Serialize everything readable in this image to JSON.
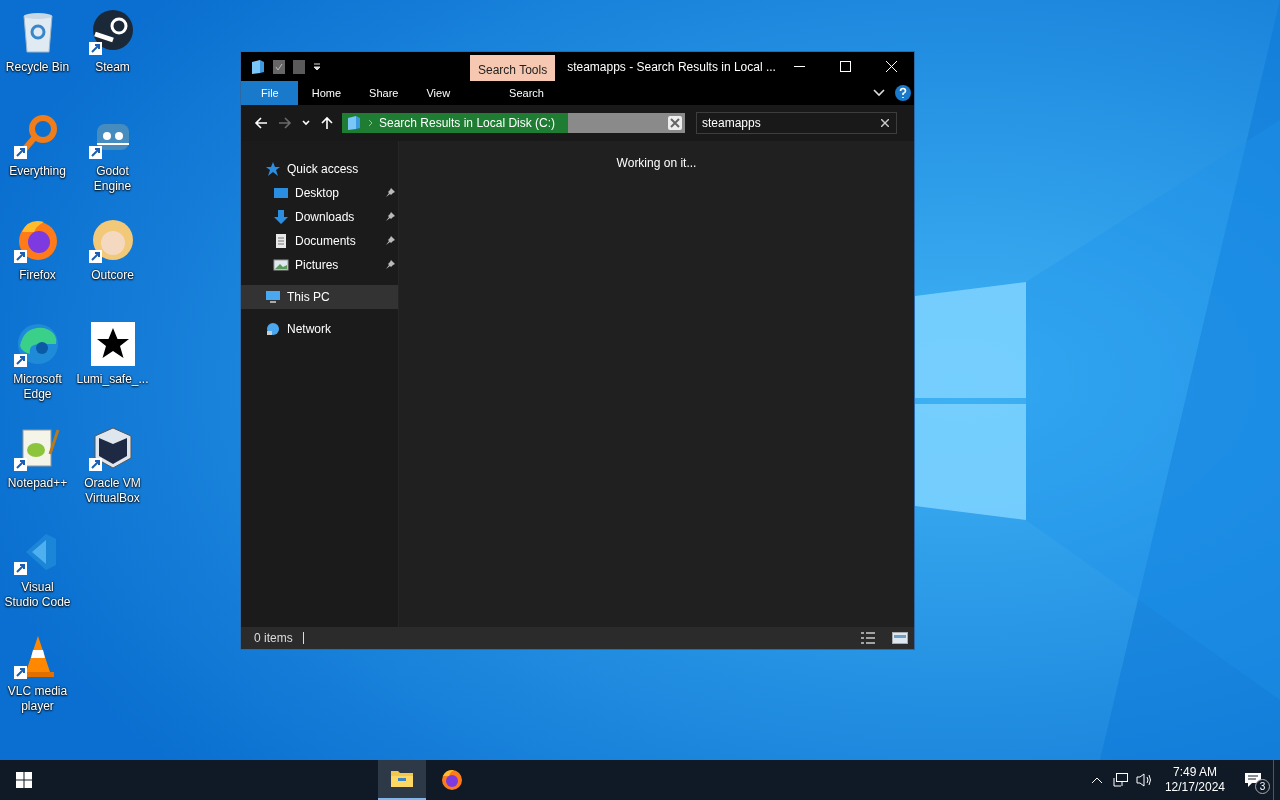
{
  "desktop": {
    "shortcuts": [
      {
        "label": "Recycle Bin",
        "shortcut": false
      },
      {
        "label": "Everything",
        "shortcut": true
      },
      {
        "label": "Firefox",
        "shortcut": true
      },
      {
        "label": "Microsoft Edge",
        "shortcut": true
      },
      {
        "label": "Notepad++",
        "shortcut": true
      },
      {
        "label": "Visual Studio Code",
        "shortcut": true
      },
      {
        "label": "VLC media player",
        "shortcut": true
      },
      {
        "label": "Steam",
        "shortcut": true
      },
      {
        "label": "Godot Engine",
        "shortcut": true
      },
      {
        "label": "Outcore",
        "shortcut": true
      },
      {
        "label": "Lumi_safe_...",
        "shortcut": false
      },
      {
        "label": "Oracle VM VirtualBox",
        "shortcut": true
      }
    ]
  },
  "explorer": {
    "title": "steamapps - Search Results in Local ...",
    "context_tab": "Search Tools",
    "ribbon_tabs": [
      {
        "label": "File",
        "kind": "file"
      },
      {
        "label": "Home",
        "kind": "tab"
      },
      {
        "label": "Share",
        "kind": "tab"
      },
      {
        "label": "View",
        "kind": "tab"
      },
      {
        "label": "Search",
        "kind": "context"
      }
    ],
    "nav_buttons": [
      {
        "kind": "back",
        "disabled": false
      },
      {
        "kind": "forward",
        "disabled": true
      },
      {
        "kind": "recent",
        "disabled": false
      },
      {
        "kind": "up",
        "disabled": false
      }
    ],
    "address": {
      "path": "Search Results in Local Disk (C:)",
      "level": 0.7
    },
    "search": {
      "value": "steamapps"
    },
    "nav_pane": [
      {
        "label": "Quick access",
        "selected": false,
        "children": [
          {
            "label": "Desktop",
            "pinned": true,
            "selected": false
          },
          {
            "label": "Downloads",
            "pinned": true,
            "selected": false
          },
          {
            "label": "Documents",
            "pinned": true,
            "selected": false
          },
          {
            "label": "Pictures",
            "pinned": true,
            "selected": false
          }
        ]
      },
      {
        "label": "This PC",
        "selected": true
      },
      {
        "label": "Network",
        "selected": false
      }
    ],
    "message": "Working on it...",
    "status": "0 items"
  },
  "taskbar": {
    "apps": [
      {
        "kind": "folder",
        "active": true
      },
      {
        "kind": "browser",
        "active": false
      }
    ],
    "time": "7:49 AM",
    "date": "12/17/2024",
    "notifications": "3"
  }
}
